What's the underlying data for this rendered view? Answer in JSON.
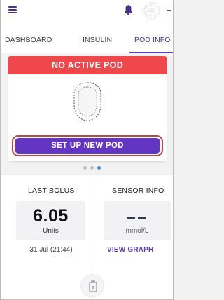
{
  "tabs": [
    {
      "label": "DASHBOARD",
      "active": false
    },
    {
      "label": "INSULIN",
      "active": false
    },
    {
      "label": "POD INFO",
      "active": true
    }
  ],
  "pod": {
    "banner": "NO ACTIVE POD",
    "setup_button": "SET UP NEW POD"
  },
  "pager": {
    "count": 3,
    "active_index": 2
  },
  "last_bolus": {
    "title": "LAST BOLUS",
    "value": "6.05",
    "unit": "Units",
    "date": "31 Jul (21:44)"
  },
  "sensor_info": {
    "title": "SENSOR INFO",
    "value": "--",
    "unit": "mmol/L",
    "link": "VIEW GRAPH"
  },
  "icons": {
    "menu": "hamburger-menu-icon",
    "notification": "bell-icon",
    "status": "status-ring-icon",
    "bolus": "bolus-button-icon"
  },
  "colors": {
    "accent": "#5b3fb4",
    "banner": "#f0474d",
    "button": "#6434c2",
    "active_dot": "#3d8be0"
  }
}
